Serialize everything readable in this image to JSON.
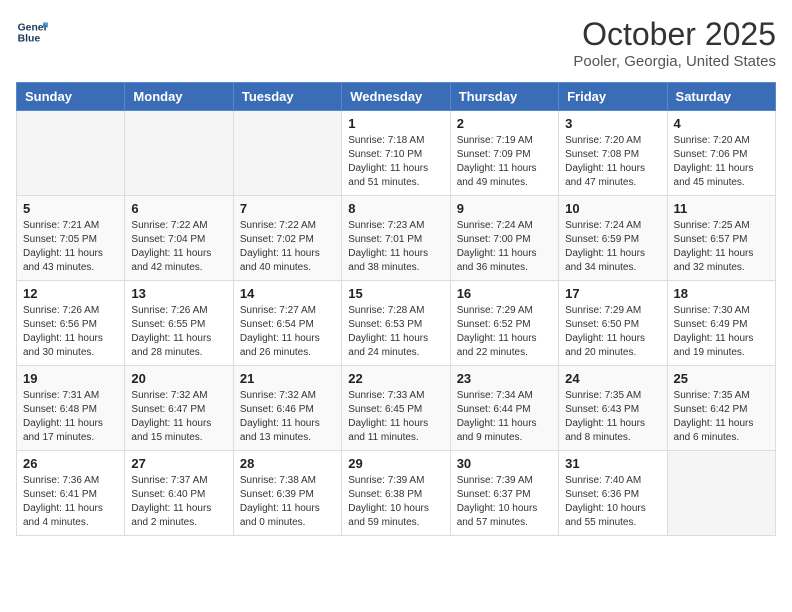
{
  "header": {
    "logo_line1": "General",
    "logo_line2": "Blue",
    "month": "October 2025",
    "location": "Pooler, Georgia, United States"
  },
  "days_of_week": [
    "Sunday",
    "Monday",
    "Tuesday",
    "Wednesday",
    "Thursday",
    "Friday",
    "Saturday"
  ],
  "weeks": [
    [
      {
        "num": "",
        "info": ""
      },
      {
        "num": "",
        "info": ""
      },
      {
        "num": "",
        "info": ""
      },
      {
        "num": "1",
        "info": "Sunrise: 7:18 AM\nSunset: 7:10 PM\nDaylight: 11 hours and 51 minutes."
      },
      {
        "num": "2",
        "info": "Sunrise: 7:19 AM\nSunset: 7:09 PM\nDaylight: 11 hours and 49 minutes."
      },
      {
        "num": "3",
        "info": "Sunrise: 7:20 AM\nSunset: 7:08 PM\nDaylight: 11 hours and 47 minutes."
      },
      {
        "num": "4",
        "info": "Sunrise: 7:20 AM\nSunset: 7:06 PM\nDaylight: 11 hours and 45 minutes."
      }
    ],
    [
      {
        "num": "5",
        "info": "Sunrise: 7:21 AM\nSunset: 7:05 PM\nDaylight: 11 hours and 43 minutes."
      },
      {
        "num": "6",
        "info": "Sunrise: 7:22 AM\nSunset: 7:04 PM\nDaylight: 11 hours and 42 minutes."
      },
      {
        "num": "7",
        "info": "Sunrise: 7:22 AM\nSunset: 7:02 PM\nDaylight: 11 hours and 40 minutes."
      },
      {
        "num": "8",
        "info": "Sunrise: 7:23 AM\nSunset: 7:01 PM\nDaylight: 11 hours and 38 minutes."
      },
      {
        "num": "9",
        "info": "Sunrise: 7:24 AM\nSunset: 7:00 PM\nDaylight: 11 hours and 36 minutes."
      },
      {
        "num": "10",
        "info": "Sunrise: 7:24 AM\nSunset: 6:59 PM\nDaylight: 11 hours and 34 minutes."
      },
      {
        "num": "11",
        "info": "Sunrise: 7:25 AM\nSunset: 6:57 PM\nDaylight: 11 hours and 32 minutes."
      }
    ],
    [
      {
        "num": "12",
        "info": "Sunrise: 7:26 AM\nSunset: 6:56 PM\nDaylight: 11 hours and 30 minutes."
      },
      {
        "num": "13",
        "info": "Sunrise: 7:26 AM\nSunset: 6:55 PM\nDaylight: 11 hours and 28 minutes."
      },
      {
        "num": "14",
        "info": "Sunrise: 7:27 AM\nSunset: 6:54 PM\nDaylight: 11 hours and 26 minutes."
      },
      {
        "num": "15",
        "info": "Sunrise: 7:28 AM\nSunset: 6:53 PM\nDaylight: 11 hours and 24 minutes."
      },
      {
        "num": "16",
        "info": "Sunrise: 7:29 AM\nSunset: 6:52 PM\nDaylight: 11 hours and 22 minutes."
      },
      {
        "num": "17",
        "info": "Sunrise: 7:29 AM\nSunset: 6:50 PM\nDaylight: 11 hours and 20 minutes."
      },
      {
        "num": "18",
        "info": "Sunrise: 7:30 AM\nSunset: 6:49 PM\nDaylight: 11 hours and 19 minutes."
      }
    ],
    [
      {
        "num": "19",
        "info": "Sunrise: 7:31 AM\nSunset: 6:48 PM\nDaylight: 11 hours and 17 minutes."
      },
      {
        "num": "20",
        "info": "Sunrise: 7:32 AM\nSunset: 6:47 PM\nDaylight: 11 hours and 15 minutes."
      },
      {
        "num": "21",
        "info": "Sunrise: 7:32 AM\nSunset: 6:46 PM\nDaylight: 11 hours and 13 minutes."
      },
      {
        "num": "22",
        "info": "Sunrise: 7:33 AM\nSunset: 6:45 PM\nDaylight: 11 hours and 11 minutes."
      },
      {
        "num": "23",
        "info": "Sunrise: 7:34 AM\nSunset: 6:44 PM\nDaylight: 11 hours and 9 minutes."
      },
      {
        "num": "24",
        "info": "Sunrise: 7:35 AM\nSunset: 6:43 PM\nDaylight: 11 hours and 8 minutes."
      },
      {
        "num": "25",
        "info": "Sunrise: 7:35 AM\nSunset: 6:42 PM\nDaylight: 11 hours and 6 minutes."
      }
    ],
    [
      {
        "num": "26",
        "info": "Sunrise: 7:36 AM\nSunset: 6:41 PM\nDaylight: 11 hours and 4 minutes."
      },
      {
        "num": "27",
        "info": "Sunrise: 7:37 AM\nSunset: 6:40 PM\nDaylight: 11 hours and 2 minutes."
      },
      {
        "num": "28",
        "info": "Sunrise: 7:38 AM\nSunset: 6:39 PM\nDaylight: 11 hours and 0 minutes."
      },
      {
        "num": "29",
        "info": "Sunrise: 7:39 AM\nSunset: 6:38 PM\nDaylight: 10 hours and 59 minutes."
      },
      {
        "num": "30",
        "info": "Sunrise: 7:39 AM\nSunset: 6:37 PM\nDaylight: 10 hours and 57 minutes."
      },
      {
        "num": "31",
        "info": "Sunrise: 7:40 AM\nSunset: 6:36 PM\nDaylight: 10 hours and 55 minutes."
      },
      {
        "num": "",
        "info": ""
      }
    ]
  ]
}
